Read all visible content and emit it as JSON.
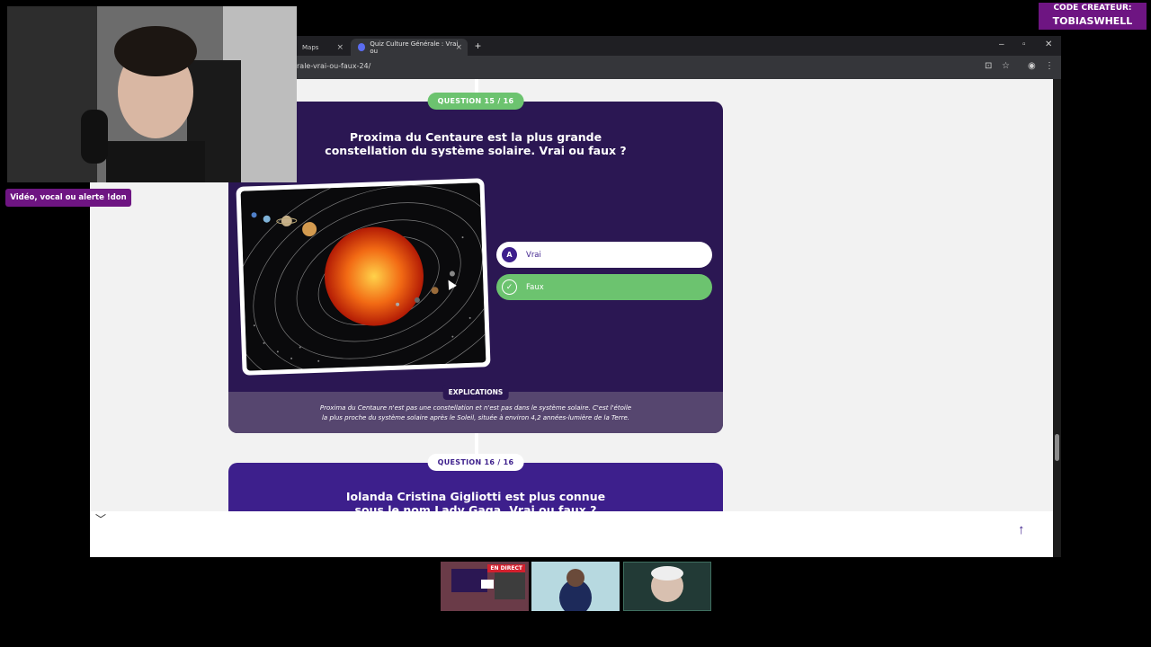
{
  "browser": {
    "tabs": [
      {
        "label": "Maps"
      },
      {
        "label": "Quiz Culture Générale : Vrai ou"
      }
    ],
    "url": "rale-vrai-ou-faux-24/",
    "new_tab_symbol": "+",
    "tab_close_symbol": "×"
  },
  "quiz": {
    "q15": {
      "badge": "QUESTION 15 / 16",
      "question_line1": "Proxima du Centaure est la plus grande",
      "question_line2": "constellation du système solaire. Vrai ou faux ?",
      "answers": [
        {
          "letter": "A",
          "label": "Vrai",
          "state": "unselected"
        },
        {
          "letter": "✓",
          "label": "Faux",
          "state": "correct"
        }
      ],
      "explain_badge": "EXPLICATIONS",
      "explanation_line1": "Proxima du Centaure n'est pas une constellation et n'est pas dans le système solaire. C'est l'étoile",
      "explanation_line2": "la plus proche du système solaire après le Soleil, située à environ 4,2 années-lumière de la Terre."
    },
    "q16": {
      "badge": "QUESTION 16 / 16",
      "question_line1": "Iolanda Cristina Gigliotti est plus connue",
      "question_line2": "sous le nom Lady Gaga. Vrai ou faux ?"
    }
  },
  "overlay": {
    "alert_button": "Vidéo, vocal ou alerte !don",
    "creator_line1": "CODE CREATEUR:",
    "creator_line2": "TOBIASWHELL",
    "live_badge": "EN DIRECT"
  },
  "colors": {
    "accent_purple": "#3d1f8c",
    "correct_green": "#6cc36f",
    "overlay_purple": "#6e1582"
  }
}
